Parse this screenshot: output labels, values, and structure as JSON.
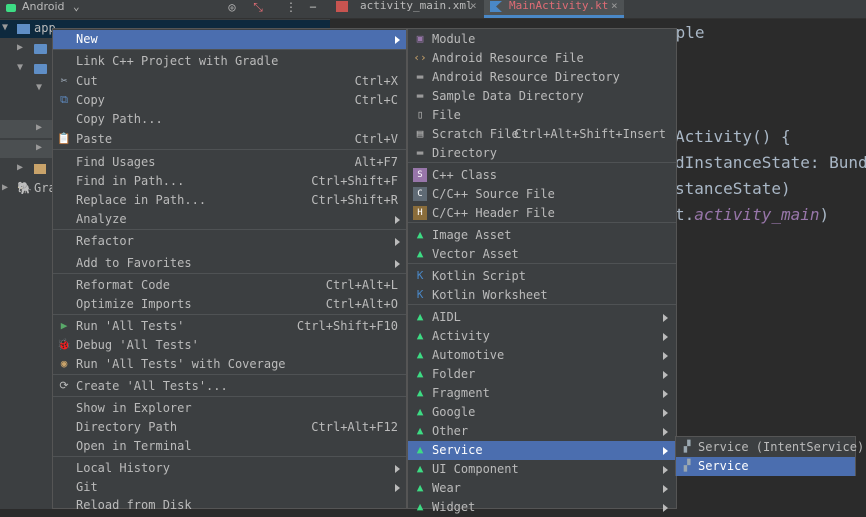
{
  "project_panel": {
    "title": "Android",
    "tree_app": "app",
    "tree_gradle": "Gra"
  },
  "tabs": [
    {
      "label": "activity_main.xml"
    },
    {
      "label": "MainActivity.kt"
    }
  ],
  "editor": {
    "lines": [
      "mple",
      "Activity() {",
      "dInstanceState: Bundle",
      "stanceState)",
      "t.",
      "activity_main",
      ")"
    ]
  },
  "context_menu": {
    "items": [
      {
        "label": "New",
        "shortcut": "",
        "submenu": true
      },
      {
        "label": "Link C++ Project with Gradle",
        "shortcut": ""
      },
      {
        "label": "Cut",
        "shortcut": "Ctrl+X"
      },
      {
        "label": "Copy",
        "shortcut": "Ctrl+C"
      },
      {
        "label": "Copy Path...",
        "shortcut": ""
      },
      {
        "label": "Paste",
        "shortcut": "Ctrl+V"
      },
      {
        "label": "Find Usages",
        "shortcut": "Alt+F7"
      },
      {
        "label": "Find in Path...",
        "shortcut": "Ctrl+Shift+F"
      },
      {
        "label": "Replace in Path...",
        "shortcut": "Ctrl+Shift+R"
      },
      {
        "label": "Analyze",
        "shortcut": "",
        "submenu": true
      },
      {
        "label": "Refactor",
        "shortcut": "",
        "submenu": true
      },
      {
        "label": "Add to Favorites",
        "shortcut": "",
        "submenu": true
      },
      {
        "label": "Reformat Code",
        "shortcut": "Ctrl+Alt+L"
      },
      {
        "label": "Optimize Imports",
        "shortcut": "Ctrl+Alt+O"
      },
      {
        "label": "Run 'All Tests'",
        "shortcut": "Ctrl+Shift+F10"
      },
      {
        "label": "Debug 'All Tests'",
        "shortcut": ""
      },
      {
        "label": "Run 'All Tests' with Coverage",
        "shortcut": ""
      },
      {
        "label": "Create 'All Tests'...",
        "shortcut": ""
      },
      {
        "label": "Show in Explorer",
        "shortcut": ""
      },
      {
        "label": "Directory Path",
        "shortcut": "Ctrl+Alt+F12"
      },
      {
        "label": "Open in Terminal",
        "shortcut": ""
      },
      {
        "label": "Local History",
        "shortcut": "",
        "submenu": true
      },
      {
        "label": "Git",
        "shortcut": "",
        "submenu": true
      },
      {
        "label": "Reload from Disk",
        "shortcut": ""
      }
    ]
  },
  "new_menu": {
    "items": [
      {
        "label": "Module",
        "shortcut": ""
      },
      {
        "label": "Android Resource File",
        "shortcut": ""
      },
      {
        "label": "Android Resource Directory",
        "shortcut": ""
      },
      {
        "label": "Sample Data Directory",
        "shortcut": ""
      },
      {
        "label": "File",
        "shortcut": ""
      },
      {
        "label": "Scratch File",
        "shortcut": "Ctrl+Alt+Shift+Insert"
      },
      {
        "label": "Directory",
        "shortcut": ""
      },
      {
        "label": "C++ Class",
        "shortcut": ""
      },
      {
        "label": "C/C++ Source File",
        "shortcut": ""
      },
      {
        "label": "C/C++ Header File",
        "shortcut": ""
      },
      {
        "label": "Image Asset",
        "shortcut": ""
      },
      {
        "label": "Vector Asset",
        "shortcut": ""
      },
      {
        "label": "Kotlin Script",
        "shortcut": ""
      },
      {
        "label": "Kotlin Worksheet",
        "shortcut": ""
      },
      {
        "label": "AIDL",
        "shortcut": "",
        "submenu": true
      },
      {
        "label": "Activity",
        "shortcut": "",
        "submenu": true
      },
      {
        "label": "Automotive",
        "shortcut": "",
        "submenu": true
      },
      {
        "label": "Folder",
        "shortcut": "",
        "submenu": true
      },
      {
        "label": "Fragment",
        "shortcut": "",
        "submenu": true
      },
      {
        "label": "Google",
        "shortcut": "",
        "submenu": true
      },
      {
        "label": "Other",
        "shortcut": "",
        "submenu": true
      },
      {
        "label": "Service",
        "shortcut": "",
        "submenu": true
      },
      {
        "label": "UI Component",
        "shortcut": "",
        "submenu": true
      },
      {
        "label": "Wear",
        "shortcut": "",
        "submenu": true
      },
      {
        "label": "Widget",
        "shortcut": "",
        "submenu": true
      }
    ]
  },
  "service_menu": {
    "items": [
      {
        "label": "Service (IntentService)"
      },
      {
        "label": "Service"
      }
    ]
  },
  "colors": {
    "selection": "#4b6eaf",
    "menu_bg": "#3c3f41",
    "android_green": "#3ddc84"
  }
}
